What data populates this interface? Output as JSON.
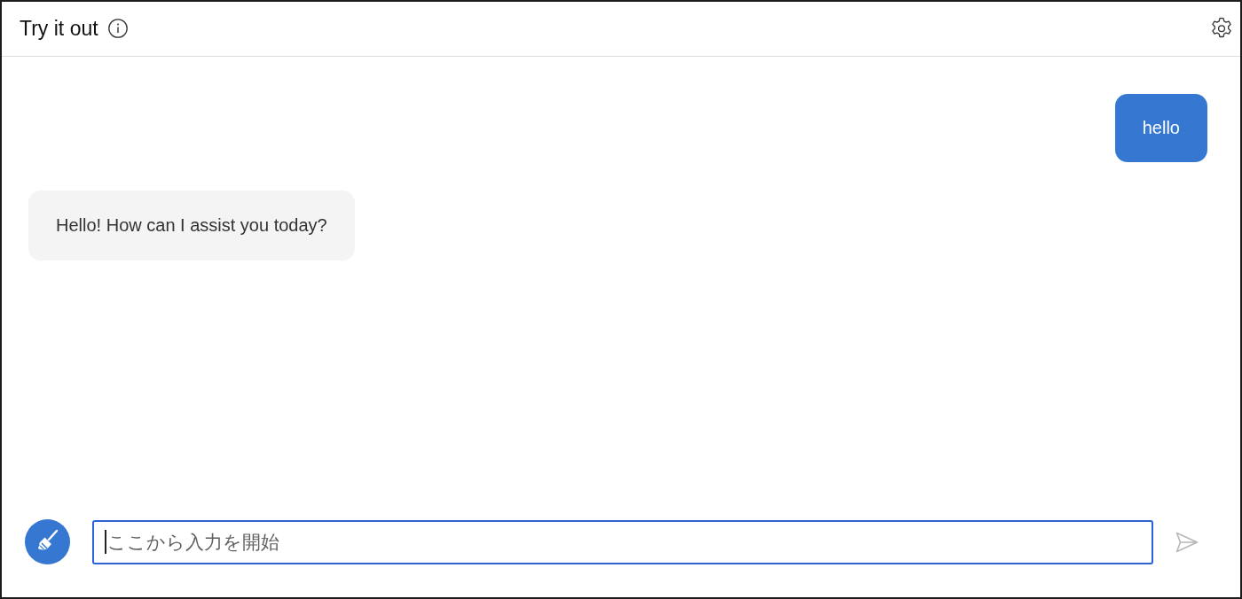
{
  "header": {
    "title": "Try it out"
  },
  "messages": [
    {
      "kind": "user",
      "text": "hello"
    },
    {
      "kind": "bot",
      "text": "Hello! How can I assist you today?"
    }
  ],
  "composer": {
    "input": {
      "placeholder": "ここから入力を開始",
      "focused": true
    },
    "send_button": {
      "disabled": true
    }
  }
}
